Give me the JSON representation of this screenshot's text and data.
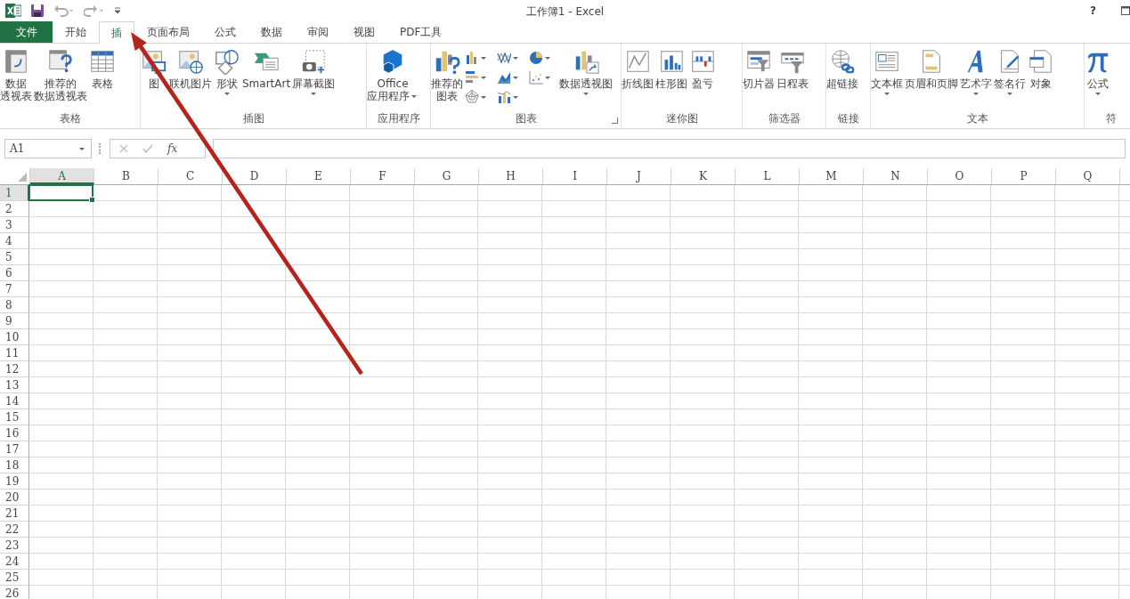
{
  "window": {
    "title": "工作簿1 - Excel",
    "help": "?"
  },
  "tabs": [
    {
      "label": "文件",
      "kind": "file",
      "selected": false
    },
    {
      "label": "开始",
      "kind": "tab",
      "selected": false
    },
    {
      "label": "插",
      "kind": "tab",
      "selected": true
    },
    {
      "label": "页面布局",
      "kind": "tab",
      "selected": false
    },
    {
      "label": "公式",
      "kind": "tab",
      "selected": false
    },
    {
      "label": "数据",
      "kind": "tab",
      "selected": false
    },
    {
      "label": "审阅",
      "kind": "tab",
      "selected": false
    },
    {
      "label": "视图",
      "kind": "tab",
      "selected": false
    },
    {
      "label": "PDF工具",
      "kind": "tab",
      "selected": false
    }
  ],
  "ribbon": {
    "groups": [
      {
        "label": "表格",
        "launcher": false,
        "items": [
          {
            "kind": "large",
            "label": [
              "数据",
              "透视表"
            ],
            "dropdown": false
          },
          {
            "kind": "large",
            "label": [
              "推荐的",
              "数据透视表"
            ],
            "dropdown": false
          },
          {
            "kind": "large",
            "label": [
              "表格"
            ],
            "dropdown": false
          }
        ]
      },
      {
        "label": "插图",
        "launcher": false,
        "items": [
          {
            "kind": "large",
            "label": [
              "图"
            ],
            "dropdown": false
          },
          {
            "kind": "large",
            "label": [
              "联机图片"
            ],
            "dropdown": false
          },
          {
            "kind": "large",
            "label": [
              "形状"
            ],
            "dropdown": true
          },
          {
            "kind": "large",
            "label": [
              "SmartArt"
            ],
            "dropdown": false
          },
          {
            "kind": "large",
            "label": [
              "屏幕截图"
            ],
            "dropdown": true
          }
        ]
      },
      {
        "label": "应用程序",
        "launcher": false,
        "items": [
          {
            "kind": "large",
            "label": [
              "Office",
              "应用程序"
            ],
            "dropdown": true
          }
        ]
      },
      {
        "label": "图表",
        "launcher": true,
        "items": [
          {
            "kind": "large",
            "label": [
              "推荐的",
              "图表"
            ],
            "dropdown": false
          },
          {
            "kind": "small",
            "dropdown": true
          },
          {
            "kind": "small",
            "dropdown": true
          },
          {
            "kind": "small",
            "dropdown": true
          },
          {
            "kind": "small",
            "dropdown": true
          },
          {
            "kind": "small",
            "dropdown": true
          },
          {
            "kind": "small",
            "dropdown": true
          },
          {
            "kind": "small",
            "dropdown": true
          },
          {
            "kind": "small",
            "dropdown": true
          },
          {
            "kind": "large",
            "label": [
              "数据透视图"
            ],
            "dropdown": true
          }
        ]
      },
      {
        "label": "迷你图",
        "launcher": false,
        "items": [
          {
            "kind": "large",
            "label": [
              "折线图"
            ],
            "dropdown": false
          },
          {
            "kind": "large",
            "label": [
              "柱形图"
            ],
            "dropdown": false
          },
          {
            "kind": "large",
            "label": [
              "盈亏"
            ],
            "dropdown": false
          }
        ]
      },
      {
        "label": "筛选器",
        "launcher": false,
        "items": [
          {
            "kind": "large",
            "label": [
              "切片器"
            ],
            "dropdown": false
          },
          {
            "kind": "large",
            "label": [
              "日程表"
            ],
            "dropdown": false
          }
        ]
      },
      {
        "label": "链接",
        "launcher": false,
        "items": [
          {
            "kind": "large",
            "label": [
              "超链接"
            ],
            "dropdown": false
          }
        ]
      },
      {
        "label": "文本",
        "launcher": false,
        "items": [
          {
            "kind": "large",
            "label": [
              "文本框"
            ],
            "dropdown": true
          },
          {
            "kind": "large",
            "label": [
              "页眉和页脚"
            ],
            "dropdown": false
          },
          {
            "kind": "large",
            "label": [
              "艺术字"
            ],
            "dropdown": true
          },
          {
            "kind": "large",
            "label": [
              "签名行"
            ],
            "dropdown": true
          },
          {
            "kind": "large",
            "label": [
              "对象"
            ],
            "dropdown": false
          }
        ]
      },
      {
        "label": "符",
        "launcher": false,
        "items": [
          {
            "kind": "large",
            "label": [
              "公式"
            ],
            "dropdown": true
          }
        ]
      }
    ]
  },
  "formula_bar": {
    "name_box": "A1",
    "function_label": "fx"
  },
  "sheet": {
    "columns": [
      {
        "label": "A",
        "selected": true
      },
      {
        "label": "B",
        "selected": false
      },
      {
        "label": "C",
        "selected": false
      },
      {
        "label": "D",
        "selected": false
      },
      {
        "label": "E",
        "selected": false
      },
      {
        "label": "F",
        "selected": false
      },
      {
        "label": "G",
        "selected": false
      },
      {
        "label": "H",
        "selected": false
      },
      {
        "label": "I",
        "selected": false
      },
      {
        "label": "J",
        "selected": false
      },
      {
        "label": "K",
        "selected": false
      },
      {
        "label": "L",
        "selected": false
      },
      {
        "label": "M",
        "selected": false
      },
      {
        "label": "N",
        "selected": false
      },
      {
        "label": "O",
        "selected": false
      },
      {
        "label": "P",
        "selected": false
      },
      {
        "label": "Q",
        "selected": false
      }
    ],
    "rows": [
      {
        "label": "1",
        "selected": true
      },
      {
        "label": "2",
        "selected": false
      },
      {
        "label": "3",
        "selected": false
      },
      {
        "label": "4",
        "selected": false
      },
      {
        "label": "5",
        "selected": false
      },
      {
        "label": "6",
        "selected": false
      },
      {
        "label": "7",
        "selected": false
      },
      {
        "label": "8",
        "selected": false
      },
      {
        "label": "9",
        "selected": false
      },
      {
        "label": "10",
        "selected": false
      },
      {
        "label": "11",
        "selected": false
      },
      {
        "label": "12",
        "selected": false
      },
      {
        "label": "13",
        "selected": false
      },
      {
        "label": "14",
        "selected": false
      },
      {
        "label": "15",
        "selected": false
      },
      {
        "label": "16",
        "selected": false
      },
      {
        "label": "17",
        "selected": false
      },
      {
        "label": "18",
        "selected": false
      },
      {
        "label": "19",
        "selected": false
      },
      {
        "label": "20",
        "selected": false
      },
      {
        "label": "21",
        "selected": false
      },
      {
        "label": "22",
        "selected": false
      },
      {
        "label": "23",
        "selected": false
      },
      {
        "label": "24",
        "selected": false
      },
      {
        "label": "25",
        "selected": false
      },
      {
        "label": "26",
        "selected": false
      }
    ]
  }
}
